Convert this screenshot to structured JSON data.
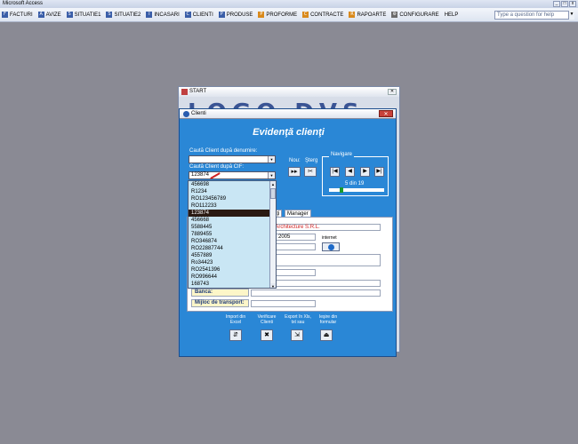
{
  "app": {
    "title": "Microsoft Access"
  },
  "menu": {
    "items": [
      {
        "icon": "F",
        "label": "FACTURI"
      },
      {
        "icon": "A",
        "label": "AVIZE"
      },
      {
        "icon": "S",
        "label": "SITUATIE1"
      },
      {
        "icon": "S",
        "label": "SITUATIE2"
      },
      {
        "icon": "I",
        "label": "INCASARI"
      },
      {
        "icon": "C",
        "label": "CLIENTI"
      },
      {
        "icon": "P",
        "label": "PRODUSE"
      },
      {
        "icon": "P",
        "label": "PROFORME"
      },
      {
        "icon": "C",
        "label": "CONTRACTE"
      },
      {
        "icon": "R",
        "label": "RAPOARTE"
      },
      {
        "icon": "⚙",
        "label": "CONFIGURARE"
      },
      {
        "icon": "",
        "label": "HELP"
      }
    ],
    "help_placeholder": "Type a question for help"
  },
  "start_window": {
    "title": "START",
    "logo": "LOGO DVS"
  },
  "clients_window": {
    "title": "Clienti",
    "close": "✕",
    "heading": "Evidenţă clienţi",
    "search_name_label": "Caută Client după denumire:",
    "search_name_value": "",
    "search_cif_label": "Caută Client după CIF:",
    "search_cif_value": "123874",
    "nou_label": "Nou:",
    "sterg_label": "Şterg",
    "navigation_label": "Navigare",
    "record_text": "5  din  19",
    "slider_fraction": 0.21,
    "dropdown_items": [
      "456698",
      "R1234",
      "RO123456789",
      "RO112233",
      "123874",
      "456668",
      "5588445",
      "7889455",
      "RO346874",
      "RO22887744",
      "4557889",
      "Ro34423",
      "RO2541396",
      "RO996644",
      "168743",
      "RO354239"
    ],
    "selected_index": 4,
    "tabs": [
      "ăţi",
      "Manager"
    ],
    "fields": {
      "company": "et Architecture S.R.L.",
      "year": "2005",
      "internet_label": "internet"
    },
    "labels": {
      "banca": "Banca:",
      "transport": "Mijloc de transport:"
    },
    "actions": [
      {
        "label": "Import din Excel",
        "icon": "⇵"
      },
      {
        "label": "Verificare Clienti",
        "icon": "✖"
      },
      {
        "label": "Export în Xls, txt sau",
        "icon": "⇲"
      },
      {
        "label": "Ieşire din formular",
        "icon": "⏏"
      }
    ]
  },
  "colors": {
    "form_bg": "#2a87d6",
    "desktop": "#8a8a94",
    "selected": "#2a1a12"
  }
}
